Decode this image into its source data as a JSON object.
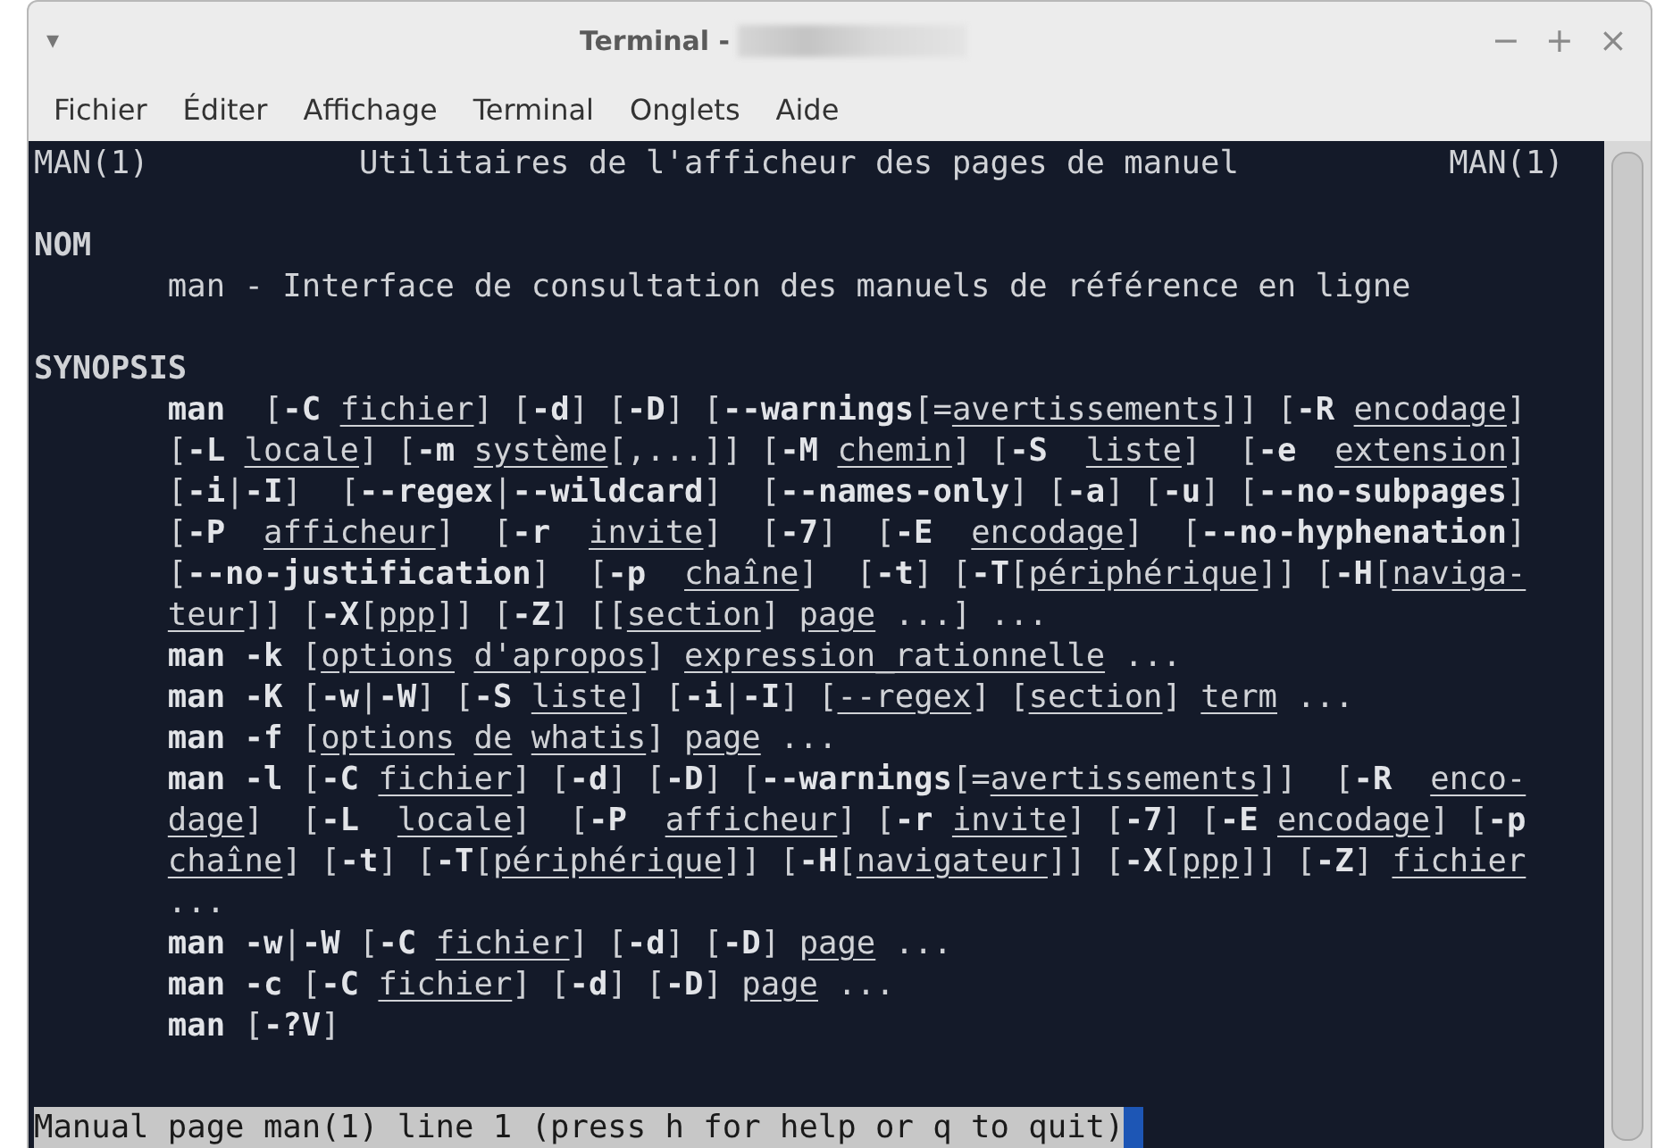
{
  "window": {
    "menu_glyph": "▾",
    "title": "Terminal -",
    "controls": [
      "−",
      "+",
      "×"
    ]
  },
  "menu": [
    "Fichier",
    "Éditer",
    "Affichage",
    "Terminal",
    "Onglets",
    "Aide"
  ],
  "terminal": {
    "header": {
      "left": "MAN(1)",
      "center": "Utilitaires de l'afficheur des pages de manuel",
      "right": "MAN(1)"
    },
    "lines": [
      {
        "kind": "heading",
        "text": "NOM"
      },
      {
        "kind": "text",
        "text": "man - Interface de consultation des manuels de référence en ligne"
      },
      {
        "kind": "heading",
        "text": "SYNOPSIS"
      },
      {
        "kind": "text",
        "text": "**man**  [**-C** *fichier*] [**-d**] [**-D**] [**--warnings**[=*avertissements*]] [**-R** *encodage*]"
      },
      {
        "kind": "text",
        "text": "[**-L** *locale*] [**-m** *système*[,...]] [**-M** *chemin*] [**-S**  *liste*]  [**-e**  *extension*]"
      },
      {
        "kind": "text",
        "text": "[**-i**|**-I**]  [**--regex**|**--wildcard**]  [**--names-only**] [**-a**] [**-u**] [**--no-subpages**]"
      },
      {
        "kind": "text",
        "text": "[**-P**  *afficheur*]  [**-r**  *invite*]  [**-7**]  [**-E**  *encodage*]  [**--no-hyphenation**]"
      },
      {
        "kind": "text",
        "text": "[**--no-justification**]  [**-p**  *chaîne*]  [**-t**] [**-T**[*périphérique*]] [**-H**[*naviga-*"
      },
      {
        "kind": "text",
        "text": "*teur*]] [**-X**[*ppp*]] [**-Z**] [[*section*] *page* ...] ..."
      },
      {
        "kind": "text",
        "text": "**man -k** [*options* *d'apropos*] *expression_rationnelle* ..."
      },
      {
        "kind": "text",
        "text": "**man -K** [**-w**|**-W**] [**-S** *liste*] [**-i**|**-I**] [*--regex*] [*section*] *term* ..."
      },
      {
        "kind": "text",
        "text": "**man -f** [*options* *de* *whatis*] *page* ..."
      },
      {
        "kind": "text",
        "text": "**man -l** [**-C** *fichier*] [**-d**] [**-D**] [**--warnings**[=*avertissements*]]  [**-R**  *enco-*"
      },
      {
        "kind": "text",
        "text": "*dage*]  [**-L**  *locale*]  [**-P**  *afficheur*] [**-r** *invite*] [**-7**] [**-E** *encodage*] [**-p**"
      },
      {
        "kind": "text",
        "text": "*chaîne*] [**-t**] [**-T**[*périphérique*]] [**-H**[*navigateur*]] [**-X**[*ppp*]] [**-Z**] *fichier*"
      },
      {
        "kind": "text",
        "text": "..."
      },
      {
        "kind": "text",
        "text": "**man -w**|**-W** [**-C** *fichier*] [**-d**] [**-D**] *page* ..."
      },
      {
        "kind": "text",
        "text": "**man -c** [**-C** *fichier*] [**-d**] [**-D**] *page* ..."
      },
      {
        "kind": "text",
        "text": "**man** [**-?V**]"
      }
    ],
    "status": "Manual page man(1) line 1 (press h for help or q to quit)"
  }
}
